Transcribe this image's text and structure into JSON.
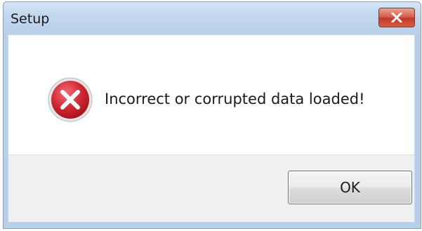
{
  "window": {
    "title": "Setup",
    "close_icon": "close-icon"
  },
  "message": {
    "icon": "error-icon",
    "text": "Incorrect or corrupted data loaded!"
  },
  "buttons": {
    "ok_label": "OK"
  },
  "colors": {
    "error_red": "#c8232c",
    "close_button_red": "#c0392b",
    "title_bar_blue": "#c3d8ef"
  }
}
